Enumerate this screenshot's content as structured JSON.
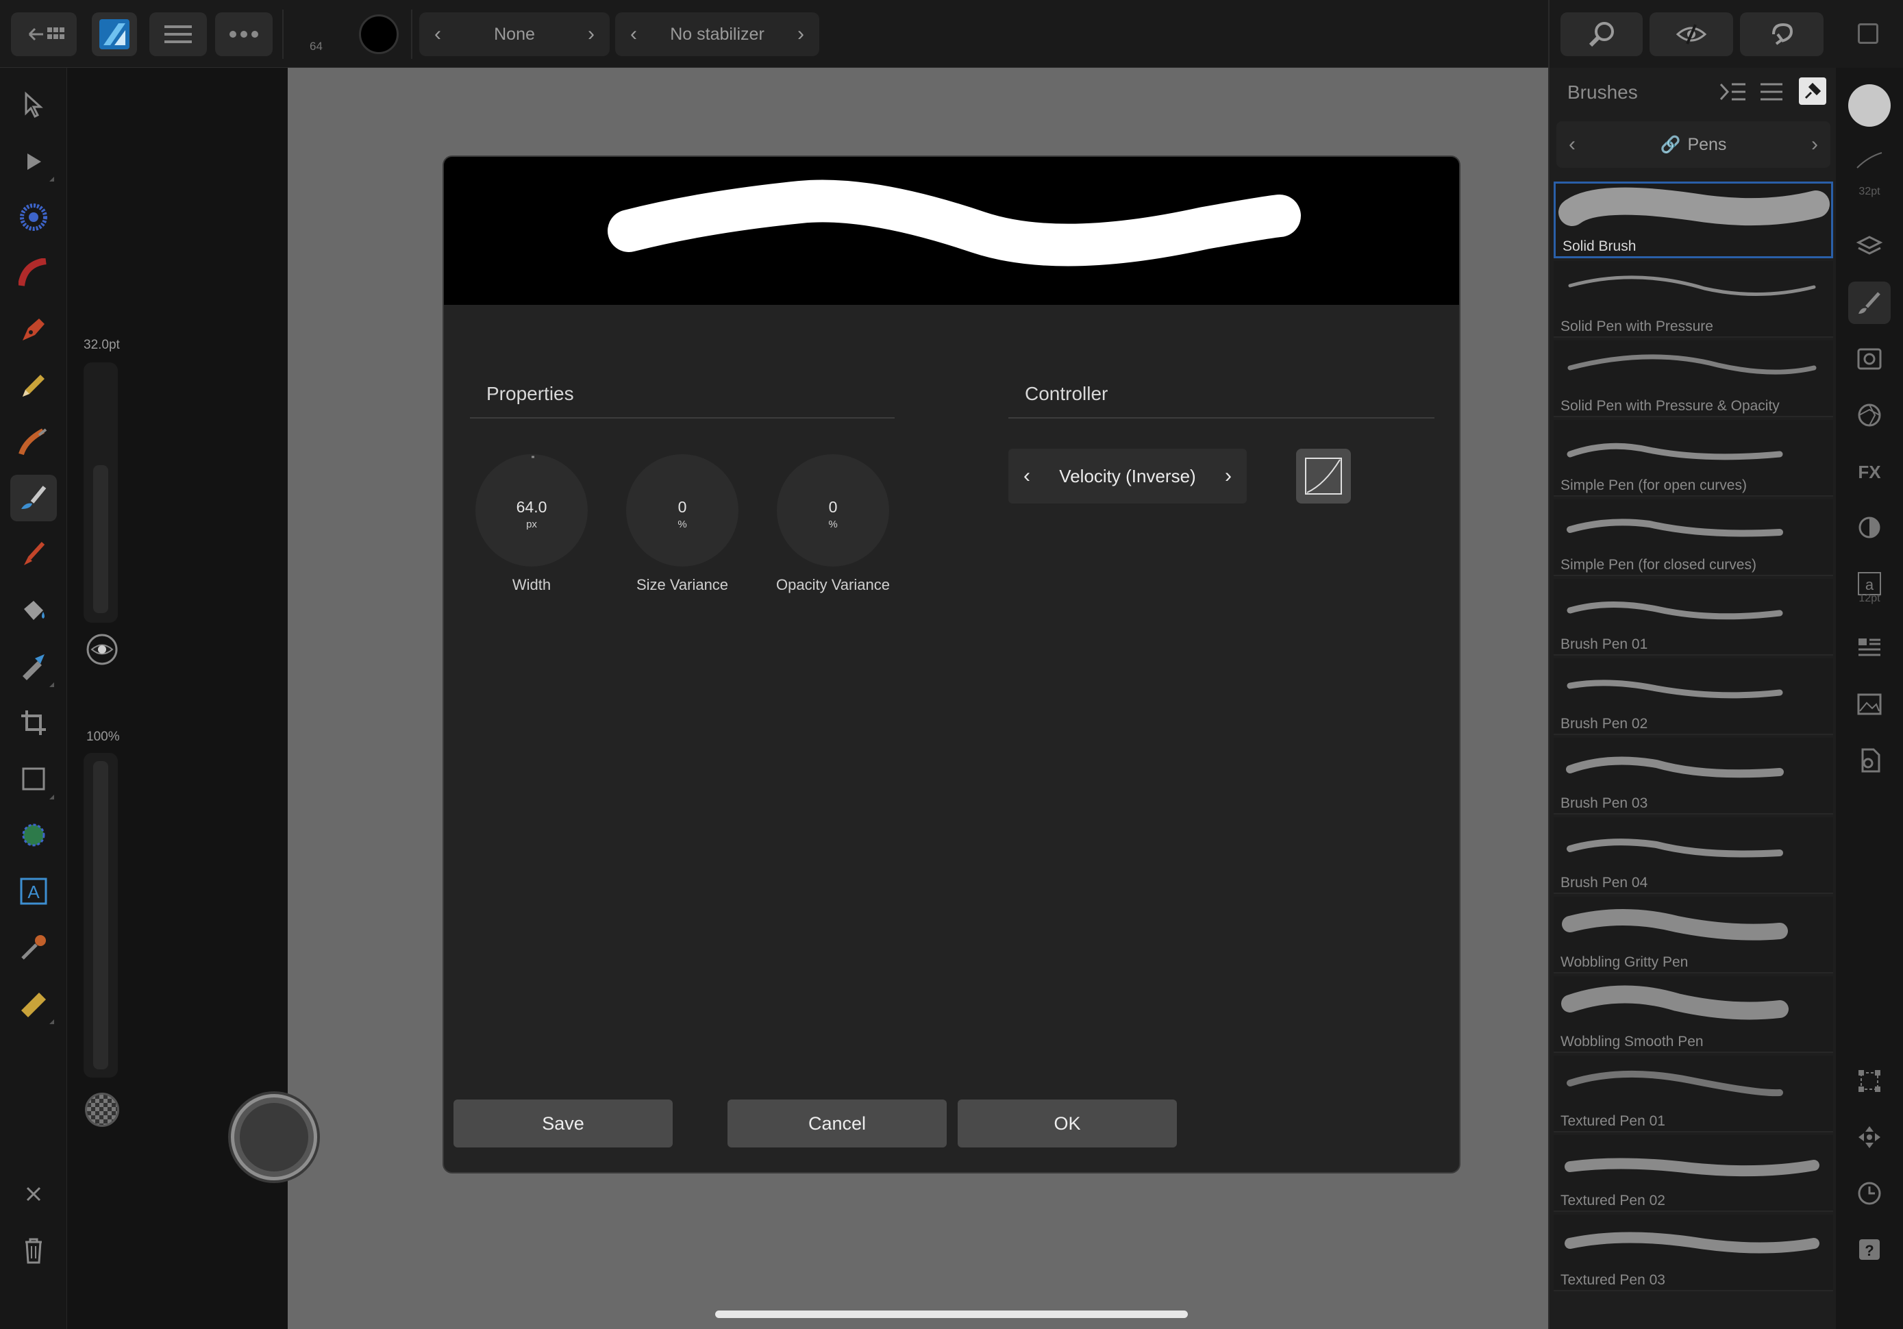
{
  "topbar": {
    "size_value": "64",
    "blend_mode": "None",
    "stabilizer": "No stabilizer"
  },
  "left_slider": {
    "size_label": "32.0pt",
    "opacity_label": "100%"
  },
  "dialog": {
    "properties_title": "Properties",
    "controller_title": "Controller",
    "knobs": [
      {
        "value": "64.0",
        "unit": "px",
        "label": "Width"
      },
      {
        "value": "0",
        "unit": "%",
        "label": "Size Variance"
      },
      {
        "value": "0",
        "unit": "%",
        "label": "Opacity Variance"
      }
    ],
    "controller_value": "Velocity (Inverse)",
    "save_label": "Save",
    "cancel_label": "Cancel",
    "ok_label": "OK"
  },
  "brush_panel": {
    "title": "Brushes",
    "category": "Pens",
    "brushes": [
      {
        "name": "Solid Brush"
      },
      {
        "name": "Solid Pen with Pressure"
      },
      {
        "name": "Solid Pen with Pressure & Opacity"
      },
      {
        "name": "Simple Pen (for open curves)"
      },
      {
        "name": "Simple Pen (for closed curves)"
      },
      {
        "name": "Brush Pen 01"
      },
      {
        "name": "Brush Pen 02"
      },
      {
        "name": "Brush Pen 03"
      },
      {
        "name": "Brush Pen 04"
      },
      {
        "name": "Wobbling Gritty Pen"
      },
      {
        "name": "Wobbling Smooth Pen"
      },
      {
        "name": "Textured Pen 01"
      },
      {
        "name": "Textured Pen 02"
      },
      {
        "name": "Textured Pen 03"
      }
    ]
  },
  "studio": {
    "brush_size_label": "32pt",
    "text_size_label": "12pt"
  },
  "colors": {
    "accent": "#2a5fa8",
    "canvas": "#6a6a6a",
    "dialog": "#232323"
  }
}
